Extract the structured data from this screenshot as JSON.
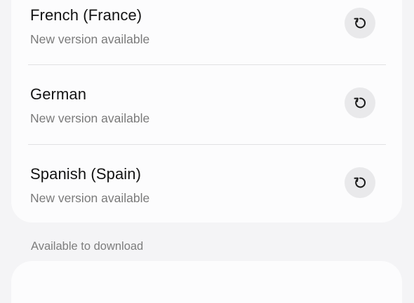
{
  "languages": {
    "items": [
      {
        "name": "French (France)",
        "status": "New version available",
        "action_icon": "update-icon"
      },
      {
        "name": "German",
        "status": "New version available",
        "action_icon": "update-icon"
      },
      {
        "name": "Spanish (Spain)",
        "status": "New version available",
        "action_icon": "update-icon"
      }
    ]
  },
  "available": {
    "header": "Available to download"
  },
  "colors": {
    "background": "#f4f4f6",
    "card": "#fcfcfd",
    "button": "#e9e9eb",
    "primary_text": "#141414",
    "secondary_text": "#7a7a7a"
  }
}
